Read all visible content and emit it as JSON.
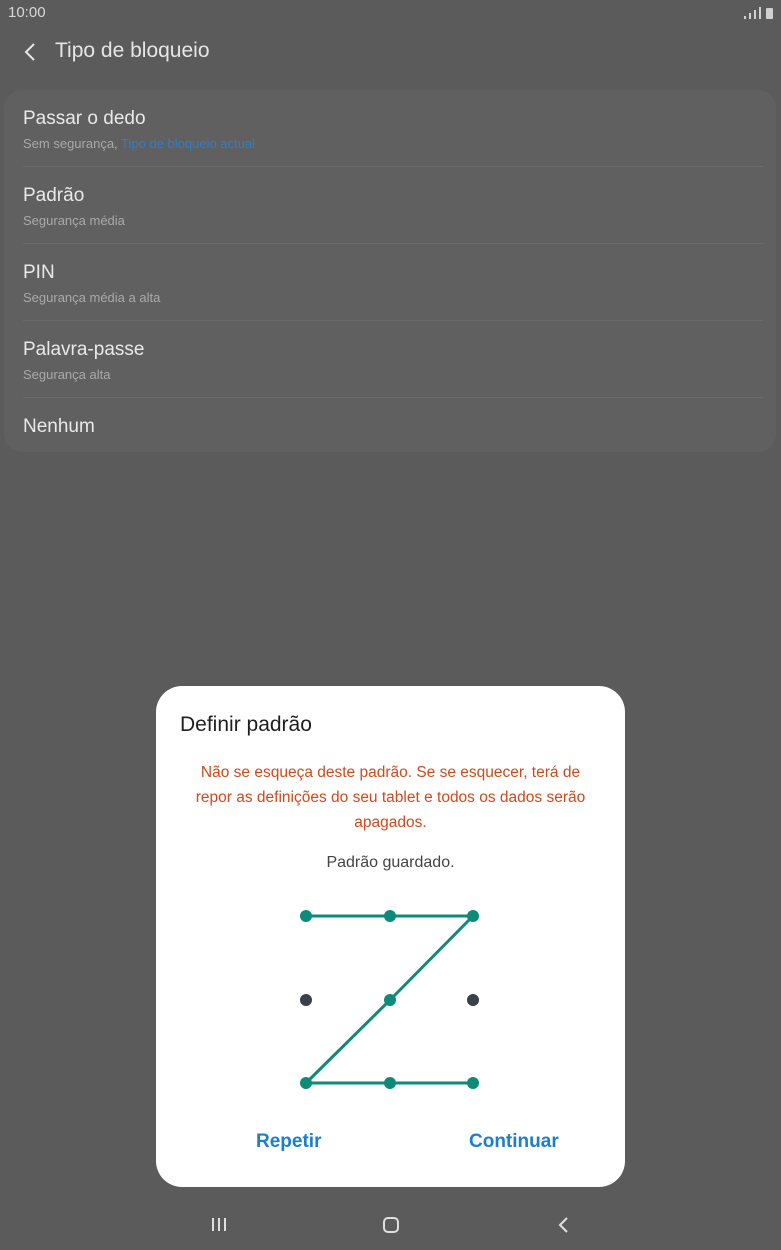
{
  "status_bar": {
    "time": "10:00"
  },
  "header": {
    "title": "Tipo de bloqueio"
  },
  "lock_types": [
    {
      "label": "Passar o dedo",
      "sub": "Sem segurança, ",
      "sub_highlight": "Tipo de bloqueio actual"
    },
    {
      "label": "Padrão",
      "sub": "Segurança média"
    },
    {
      "label": "PIN",
      "sub": "Segurança média a alta"
    },
    {
      "label": "Palavra-passe",
      "sub": "Segurança alta"
    },
    {
      "label": "Nenhum"
    }
  ],
  "dialog": {
    "title": "Definir padrão",
    "warning": "Não se esqueça deste padrão. Se se esquecer, terá de repor as definições do seu tablet e todos os dados serão apagados.",
    "status": "Padrão guardado.",
    "repeat_label": "Repetir",
    "continue_label": "Continuar",
    "pattern_sequence": [
      1,
      2,
      3,
      5,
      7,
      8,
      9
    ],
    "colors": {
      "active": "#0e8a78",
      "inactive": "#3a4048",
      "warning": "#d0491c",
      "button": "#1b7fcc"
    }
  }
}
